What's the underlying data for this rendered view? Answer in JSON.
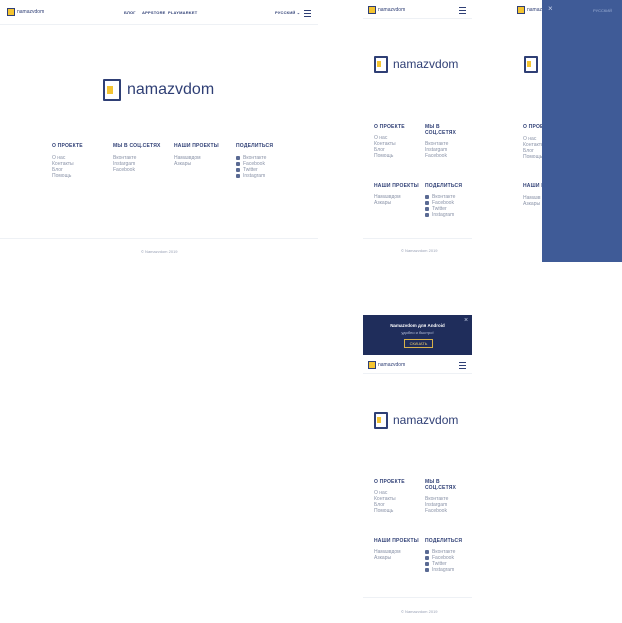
{
  "brand": {
    "name": "namazvdom",
    "colors": {
      "primary": "#2f3f75",
      "accent": "#f4c431",
      "overlay": "#3f5b97",
      "banner": "#1f2d5b"
    }
  },
  "desktop": {
    "nav": [
      "БЛОГ",
      "APPSTORE",
      "PLAYMARKET"
    ],
    "language": "РУССКИЙ",
    "footer": {
      "about": {
        "title": "О ПРОЕКТЕ",
        "links": [
          "О нас",
          "Контакты",
          "Блог",
          "Помощь"
        ]
      },
      "social": {
        "title": "МЫ В СОЦ.СЕТЯХ",
        "links": [
          "Вконтакте",
          "Instargam",
          "Facebook"
        ]
      },
      "projects": {
        "title": "НАШИ ПРОЕКТЫ",
        "links": [
          "Намазвдом",
          "Азкары"
        ]
      },
      "share": {
        "title": "ПОДЕЛИТЬСЯ",
        "links": [
          "Вконтакте",
          "Facebook",
          "Twitter",
          "Instagram"
        ]
      }
    },
    "copyright": "© Namazvdom 2019"
  },
  "mobile": {
    "footer": {
      "about": {
        "title": "О ПРОЕКТЕ",
        "links": [
          "О нас",
          "Контакты",
          "Блог",
          "Помощь"
        ]
      },
      "social": {
        "title": "МЫ В СОЦ.СЕТЯХ",
        "links": [
          "Вконтакте",
          "Instargam",
          "Facebook"
        ]
      },
      "projects": {
        "title": "НАШИ ПРОЕКТЫ",
        "links": [
          "Намазвдом",
          "Азкары"
        ]
      },
      "share": {
        "title": "ПОДЕЛИТЬСЯ",
        "links": [
          "Вконтакте",
          "Facebook",
          "Twitter",
          "Instagram"
        ]
      }
    },
    "copyright": "© Namazvdom 2019"
  },
  "menu_overlay": {
    "close_icon": "close-icon",
    "language": "РУССКИЙ",
    "cut_links": [
      "О нас",
      "Контакты",
      "Блог",
      "Помощь"
    ],
    "cut_titles": [
      "О ПРОЕ",
      "НАШИ П"
    ],
    "cut_projects": [
      "Намазв",
      "Азкары"
    ]
  },
  "app_banner": {
    "title": "Namazvdom для Android",
    "subtitle": "удобно и быстро!",
    "button": "СКАЧАТЬ"
  }
}
